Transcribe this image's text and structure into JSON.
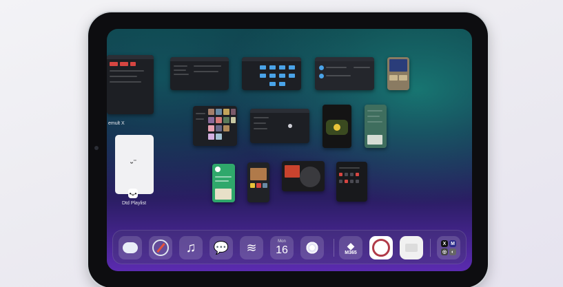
{
  "switcher": {
    "app_labels": {
      "left_top": "emult X",
      "playlist": "Dtd Playlist"
    },
    "playlist_logo": "ᵕ ̈",
    "playlist_icon_glyph": "•ᴗ•"
  },
  "dock": {
    "calendar": {
      "weekday": "Mon",
      "day": "16"
    },
    "m365_label": "M365",
    "utility_folder": [
      "X",
      "M",
      "◎",
      "◐"
    ],
    "icons": [
      "messages-icon",
      "safari-icon",
      "music-icon",
      "wechat-icon",
      "wave-app-icon",
      "calendar-icon",
      "photos-icon",
      "microsoft-365-icon",
      "ring-app-icon",
      "notes-widget-icon",
      "utility-folder-icon"
    ]
  },
  "colors": {
    "wallpaper_top": "#0f3d48",
    "wallpaper_bottom": "#5b2bb0",
    "folder_blue": "#4aa3e8",
    "accent_red": "#e5533c"
  }
}
